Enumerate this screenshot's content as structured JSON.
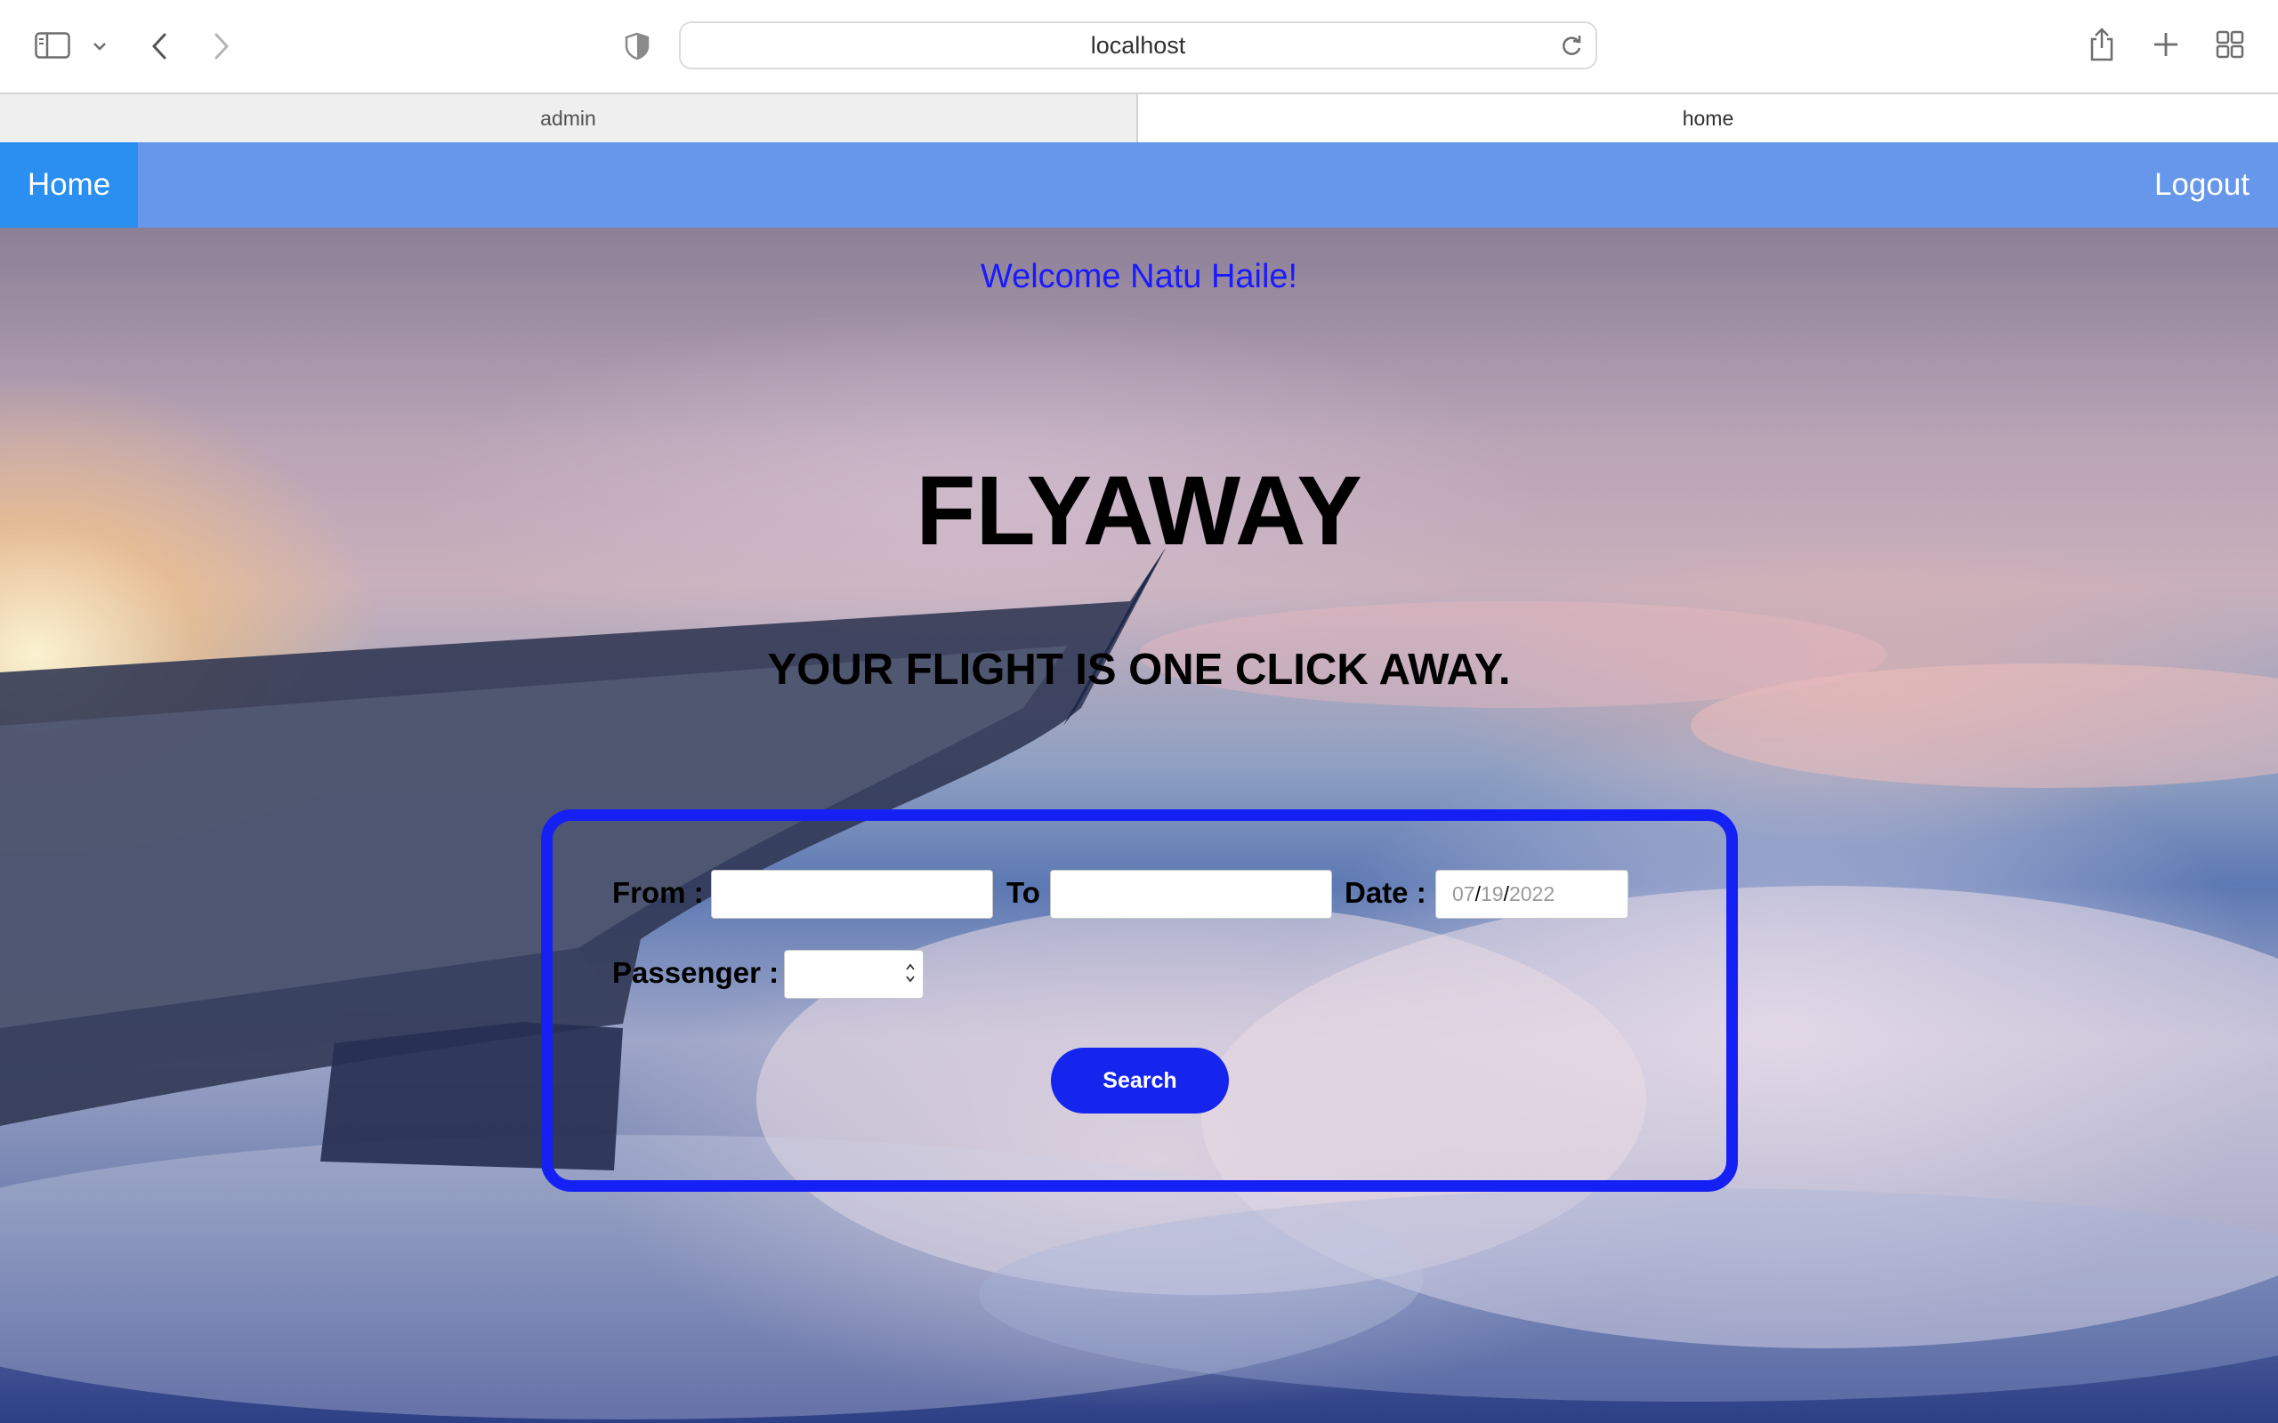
{
  "browser": {
    "url": "localhost",
    "tabs": [
      {
        "label": "admin",
        "active": false
      },
      {
        "label": "home",
        "active": true
      }
    ],
    "icons": [
      "sidebar-icon",
      "chevron-down-icon",
      "back-icon",
      "forward-icon",
      "shield-icon",
      "reload-icon",
      "share-icon",
      "new-tab-icon",
      "tab-overview-icon"
    ]
  },
  "nav": {
    "home_label": "Home",
    "logout_label": "Logout",
    "bar_color": "#6797ea",
    "home_color": "#2a8ff0"
  },
  "hero": {
    "welcome": "Welcome Natu Haile!",
    "brand": "FLYAWAY",
    "tagline": "YOUR FLIGHT IS ONE CLICK AWAY."
  },
  "search_form": {
    "from_label": "From :",
    "from_value": "",
    "to_label": "To",
    "to_value": "",
    "date_label": "Date :",
    "date_month": "07",
    "date_day": "19",
    "date_year": "2022",
    "date_separator": "/",
    "passenger_label": "Passenger :",
    "passenger_value": "",
    "search_label": "Search",
    "accent_color": "#1520f5"
  }
}
